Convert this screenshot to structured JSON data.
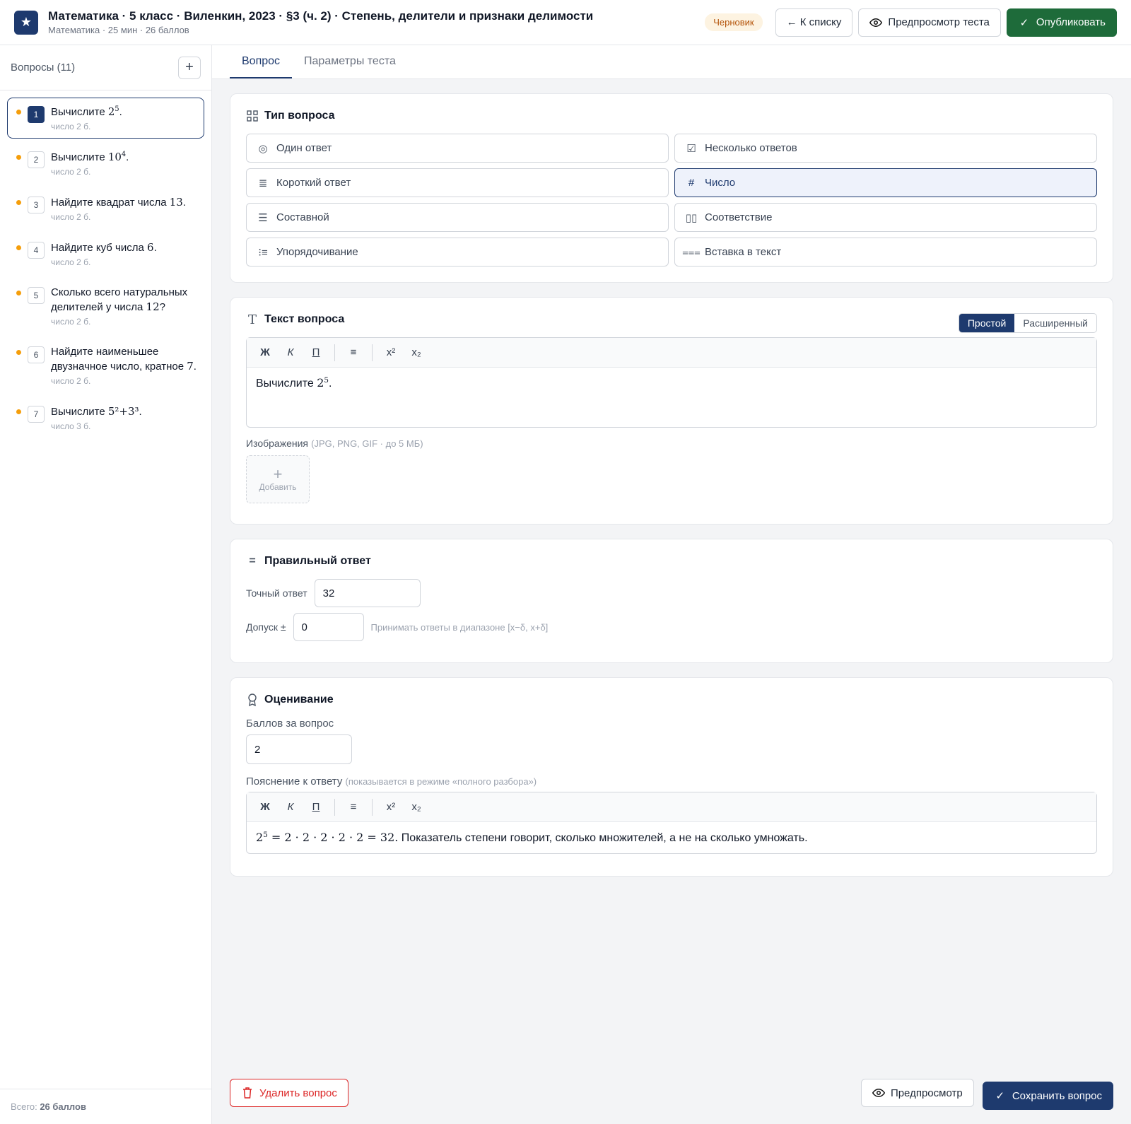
{
  "header": {
    "title": "Математика · 5 класс · Виленкин, 2023 · §3 (ч. 2) · Степень, делители и признаки делимости",
    "subtitle": "Математика · 25 мин · 26 баллов",
    "status_badge": "Черновик",
    "back_label": "← К списку",
    "preview_test_label": "Предпросмотр теста",
    "publish_label": "Опубликовать"
  },
  "sidebar": {
    "title": "Вопросы (11)",
    "add_icon": "plus-icon",
    "footer_prefix": "Всего: ",
    "footer_points": "26 баллов",
    "items": [
      {
        "num": "1",
        "text": "Вычислите ",
        "math": "2",
        "sup": "5",
        "tail": ".",
        "meta": "число  2 б."
      },
      {
        "num": "2",
        "text": "Вычислите ",
        "math": "10",
        "sup": "4",
        "tail": ".",
        "meta": "число  2 б."
      },
      {
        "num": "3",
        "text": "Найдите квадрат числа ",
        "math": "13",
        "sup": "",
        "tail": ".",
        "meta": "число  2 б."
      },
      {
        "num": "4",
        "text": "Найдите куб числа ",
        "math": "6",
        "sup": "",
        "tail": ".",
        "meta": "число  2 б."
      },
      {
        "num": "5",
        "text": "Сколько всего натуральных делителей у числа ",
        "math": "12",
        "sup": "",
        "tail": "?",
        "meta": "число  2 б."
      },
      {
        "num": "6",
        "text": "Найдите наименьшее двузначное число, кратное ",
        "math": "7",
        "sup": "",
        "tail": ".",
        "meta": "число  2 б."
      },
      {
        "num": "7",
        "text": "Вычислите ",
        "math": "5²+3³",
        "sup": "",
        "tail": ".",
        "meta": "число  3 б."
      }
    ]
  },
  "tabs": {
    "question": "Вопрос",
    "test_params": "Параметры теста"
  },
  "type_card": {
    "title": "Тип вопроса",
    "options": {
      "single": "Один ответ",
      "multiple": "Несколько ответов",
      "short": "Короткий ответ",
      "number": "Число",
      "composite": "Составной",
      "matching": "Соответствие",
      "ordering": "Упорядочивание",
      "fill_in": "Вставка в текст"
    }
  },
  "text_card": {
    "title": "Текст вопроса",
    "mode_simple": "Простой",
    "mode_advanced": "Расширенный",
    "toolbar": {
      "bold": "Ж",
      "italic": "К",
      "underline": "П",
      "list": "≡",
      "sup": "x²",
      "sub": "x₂"
    },
    "content_text": "Вычислите ",
    "content_math": "2",
    "content_sup": "5",
    "content_tail": ".",
    "images_label": "Изображения",
    "images_hint": "(JPG, PNG, GIF · до 5 МБ)",
    "add_image_label": "Добавить"
  },
  "answer_card": {
    "title": "Правильный ответ",
    "exact_label": "Точный ответ",
    "exact_value": "32",
    "tolerance_label": "Допуск ±",
    "tolerance_value": "0",
    "tolerance_hint": "Принимать ответы в диапазоне [x−δ, x+δ]"
  },
  "grading_card": {
    "title": "Оценивание",
    "points_label": "Баллов за вопрос",
    "points_value": "2",
    "explanation_label": "Пояснение к ответу",
    "explanation_hint": "(показывается в режиме «полного разбора»)",
    "explanation_math_base": "2",
    "explanation_math_sup": "5",
    "explanation_math_rest": " = 2 · 2 · 2 · 2 · 2 = 32.",
    "explanation_text": " Показатель степени говорит, сколько множителей, а не на сколько умножать."
  },
  "footer": {
    "delete_label": "Удалить вопрос",
    "preview_label": "Предпросмотр",
    "save_label": "Сохранить вопрос"
  }
}
